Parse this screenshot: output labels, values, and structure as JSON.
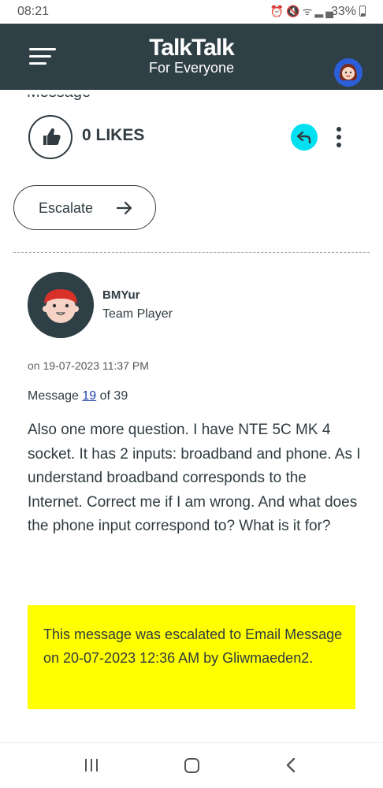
{
  "status_bar": {
    "time": "08:21",
    "battery": "33%",
    "icons": [
      "alarm-icon",
      "mute-icon",
      "wifi-icon",
      "wifi-calling-icon",
      "signal-icon",
      "battery-icon"
    ]
  },
  "header": {
    "brand_name": "TalkTalk",
    "tagline": "For Everyone"
  },
  "previous_text_fragment": "Message",
  "actions": {
    "likes_label": "0 LIKES",
    "escalate_label": "Escalate"
  },
  "post": {
    "author_name": "BMYur",
    "author_rank": "Team Player",
    "date_prefix": "on",
    "date": "19-07-2023",
    "time": "11:37 PM",
    "message_label": "Message",
    "message_number": "19",
    "message_of": "of 39",
    "body": "Also one more question. I have NTE 5C MK 4 socket. It has 2 inputs: broadband and phone. As I understand broadband corresponds to the Internet. Correct me if I am wrong. And what does the phone input correspond to? What is it for?"
  },
  "escalation_note": "This message was escalated to Email Message on 20-07-2023 12:36 AM by Gliwmaeden2.",
  "colors": {
    "header_bg": "#2f3f46",
    "reply_accent": "#00e0f0",
    "note_bg": "#ffff00",
    "link": "#1a3fa8",
    "text": "#2f3b40"
  }
}
